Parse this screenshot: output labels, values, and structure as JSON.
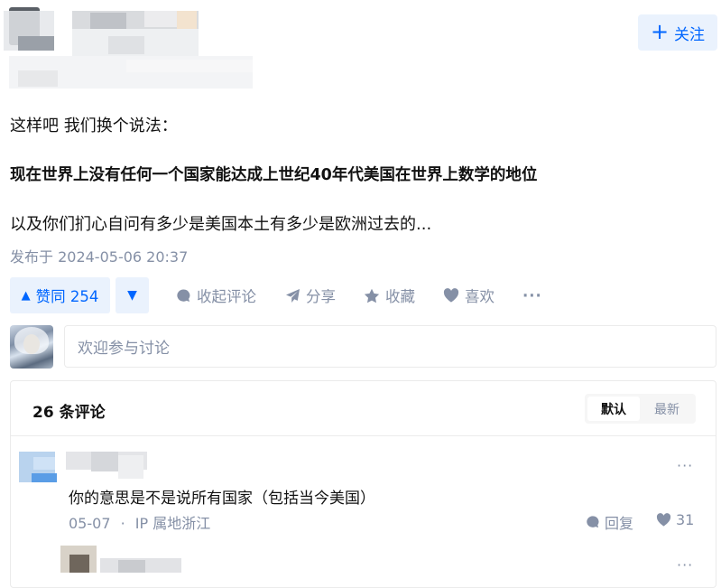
{
  "header": {
    "follow_label": "关注"
  },
  "answer": {
    "line1": "这样吧 我们换个说法：",
    "line2": "现在世界上没有任何一个国家能达成上世纪40年代美国在世界上数学的地位",
    "line3": "以及你们扪心自问有多少是美国本土有多少是欧洲过去的...",
    "published": "发布于 2024-05-06 20:37"
  },
  "actions": {
    "upvote_label": "赞同 254",
    "collapse_comments": "收起评论",
    "share": "分享",
    "collect": "收藏",
    "like": "喜欢",
    "more": "···"
  },
  "comment_box": {
    "placeholder": "欢迎参与讨论"
  },
  "comments": {
    "count_title": "26 条评论",
    "sort_default": "默认",
    "sort_latest": "最新",
    "items": [
      {
        "text": "你的意思是不是说所有国家（包括当今美国）",
        "date": "05-07",
        "separator": "·",
        "location": "IP 属地浙江",
        "reply_label": "回复",
        "likes": "31",
        "more": "···"
      },
      {
        "more": "···"
      }
    ]
  },
  "colors": {
    "accent": "#0066ff",
    "accent_bg": "#eaf2fd",
    "muted": "#8590a6",
    "border": "#ebebeb"
  }
}
